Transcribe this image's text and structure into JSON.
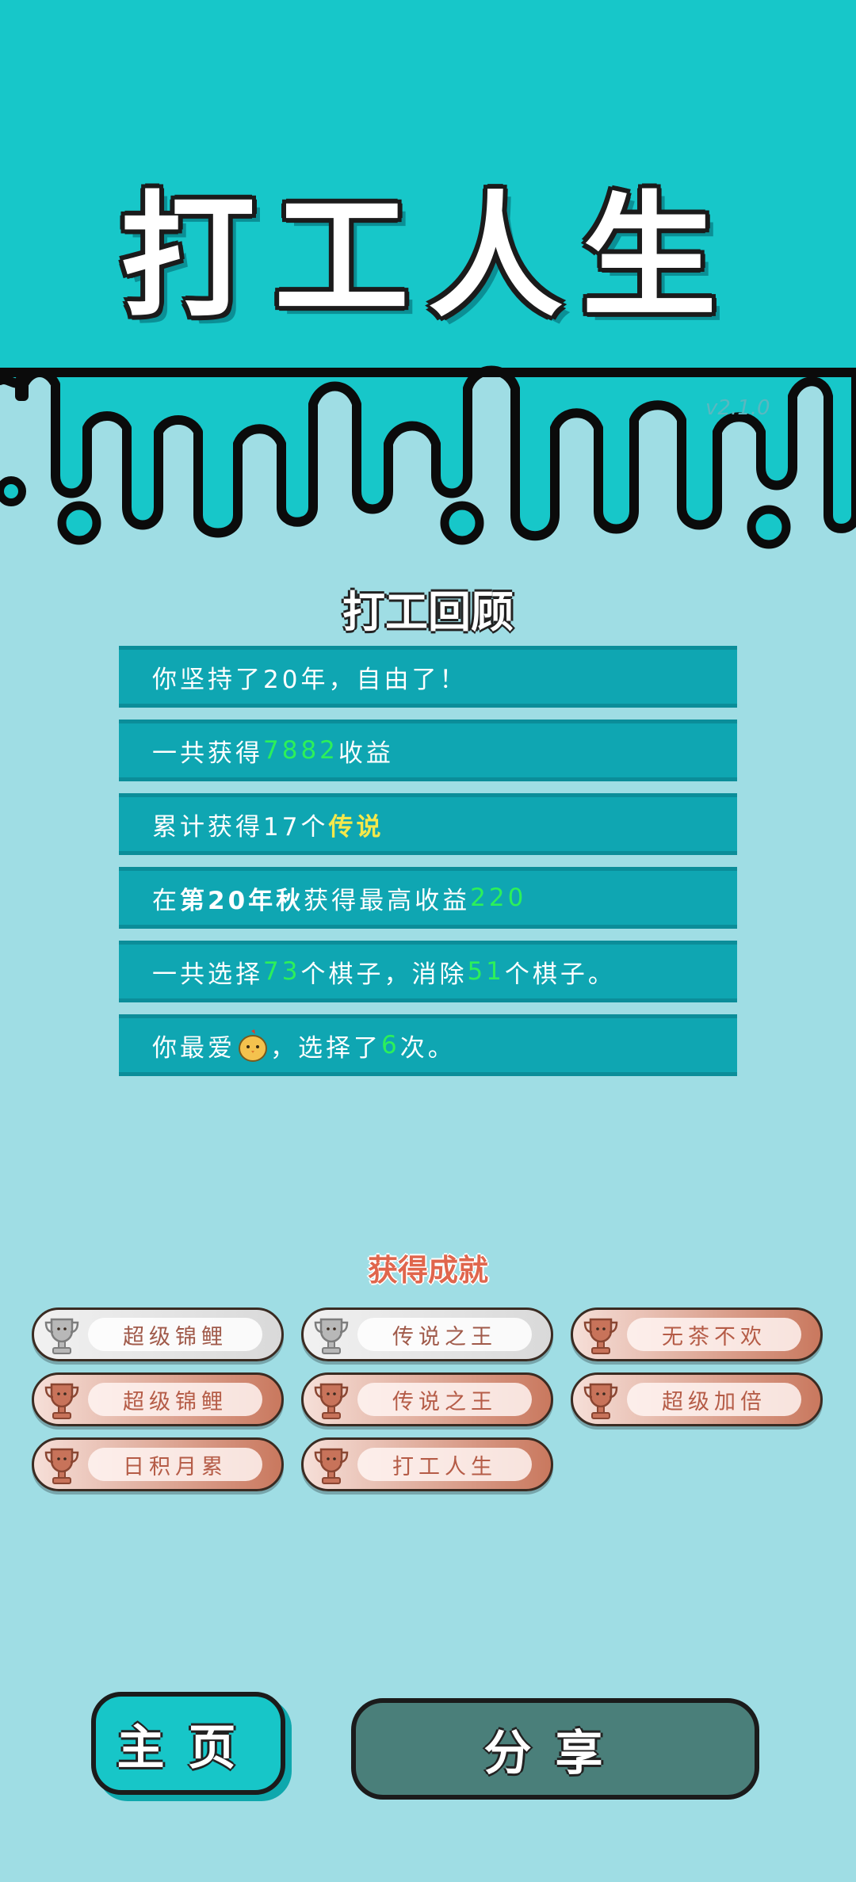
{
  "header": {
    "app_title": "打工人生",
    "version": "v2.1.0"
  },
  "review": {
    "title": "打工回顾",
    "rows": [
      {
        "parts": [
          {
            "text": "你坚持了20年，自由了！"
          }
        ]
      },
      {
        "parts": [
          {
            "text": "一共获得"
          },
          {
            "text": "7882",
            "style": "green"
          },
          {
            "text": "收益"
          }
        ]
      },
      {
        "parts": [
          {
            "text": "累计获得17个"
          },
          {
            "text": "传说",
            "style": "yellow"
          }
        ]
      },
      {
        "parts": [
          {
            "text": "在"
          },
          {
            "text": " 第20年秋 ",
            "style": "bold"
          },
          {
            "text": "获得最高收益"
          },
          {
            "text": "220",
            "style": "green"
          }
        ]
      },
      {
        "parts": [
          {
            "text": "一共选择"
          },
          {
            "text": "73",
            "style": "green"
          },
          {
            "text": "个棋子，消除"
          },
          {
            "text": "51",
            "style": "green"
          },
          {
            "text": "个棋子。"
          }
        ]
      },
      {
        "parts": [
          {
            "text": "你最爱"
          },
          {
            "icon": "chick-icon"
          },
          {
            "text": "，选择了"
          },
          {
            "text": "6",
            "style": "green"
          },
          {
            "text": "次。"
          }
        ]
      }
    ]
  },
  "achievements": {
    "title": "获得成就",
    "badges": [
      {
        "label": "超级锦鲤",
        "tier": "silver"
      },
      {
        "label": "传说之王",
        "tier": "silver"
      },
      {
        "label": "无茶不欢",
        "tier": "bronze"
      },
      {
        "label": "超级锦鲤",
        "tier": "bronze"
      },
      {
        "label": "传说之王",
        "tier": "bronze"
      },
      {
        "label": "超级加倍",
        "tier": "bronze"
      },
      {
        "label": "日积月累",
        "tier": "bronze"
      },
      {
        "label": "打工人生",
        "tier": "bronze"
      }
    ]
  },
  "buttons": {
    "home": "主页",
    "share": "分享"
  },
  "colors": {
    "top_band": "#17c7c9",
    "background": "#9fdde4",
    "row": "#0fa6b2",
    "green_value": "#2cf05a",
    "yellow_value": "#f5e84a"
  }
}
